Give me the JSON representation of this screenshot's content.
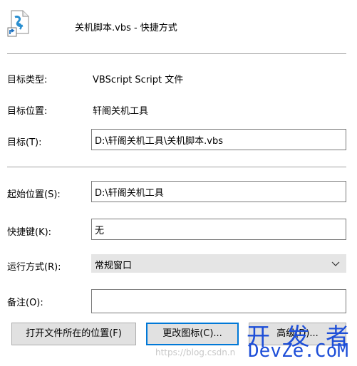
{
  "header": {
    "title": "关机脚本.vbs - 快捷方式",
    "icon": "vbs-shortcut-file-icon"
  },
  "info": {
    "type_label": "目标类型:",
    "type_value": "VBScript Script 文件",
    "location_label": "目标位置:",
    "location_value": "轩阁关机工具",
    "target_label": "目标(T):",
    "target_value": "D:\\轩阁关机工具\\关机脚本.vbs"
  },
  "fields": {
    "start_in_label": "起始位置(S):",
    "start_in_value": "D:\\轩阁关机工具",
    "hotkey_label": "快捷键(K):",
    "hotkey_value": "无",
    "run_label": "运行方式(R):",
    "run_value": "常规窗口",
    "comment_label": "备注(O):",
    "comment_value": ""
  },
  "buttons": {
    "open_location": "打开文件所在的位置(F)",
    "change_icon": "更改图标(C)...",
    "advanced": "高级(D)..."
  },
  "watermark": {
    "line1": "开 发 者",
    "line2": "DevZe.CoM",
    "url": "https://blog.csdn.n"
  },
  "colors": {
    "focus_border": "#0078d7",
    "watermark": "#1d4ed8"
  }
}
